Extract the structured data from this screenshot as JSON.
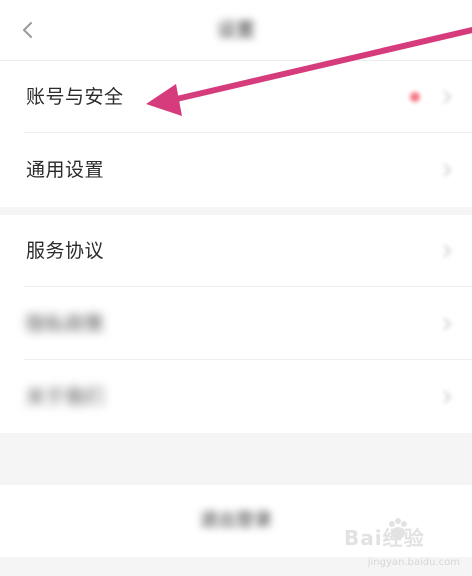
{
  "header": {
    "title": "设置"
  },
  "settings": {
    "group1": [
      {
        "label": "账号与安全",
        "has_badge": true
      },
      {
        "label": "通用设置",
        "has_badge": false
      }
    ],
    "group2": [
      {
        "label": "服务协议"
      },
      {
        "label": "隐私政策"
      },
      {
        "label": "关于我们"
      }
    ]
  },
  "logout": {
    "label": "退出登录"
  },
  "watermark": {
    "text": "Bai经验",
    "sub": "jingyan.baidu.com"
  },
  "colors": {
    "arrow": "#d63b7b",
    "badge": "#f23b4a"
  }
}
